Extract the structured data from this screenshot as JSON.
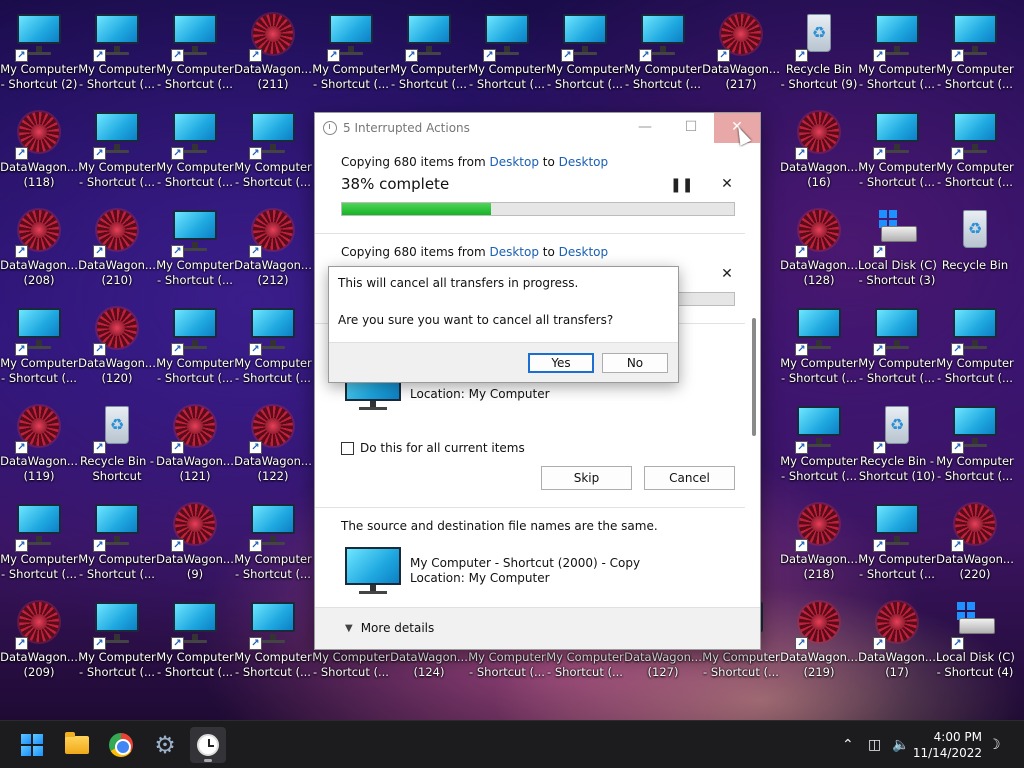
{
  "desktop_icons": [
    {
      "label1": "My Computer",
      "label2": "- Shortcut (2)",
      "kind": "monitor"
    },
    {
      "label1": "My Computer",
      "label2": "- Shortcut (...",
      "kind": "monitor"
    },
    {
      "label1": "My Computer",
      "label2": "- Shortcut (...",
      "kind": "monitor"
    },
    {
      "label1": "DataWagon...",
      "label2": "(211)",
      "kind": "flower"
    },
    {
      "label1": "My Computer",
      "label2": "- Shortcut (...",
      "kind": "monitor"
    },
    {
      "label1": "My Computer",
      "label2": "- Shortcut (...",
      "kind": "monitor"
    },
    {
      "label1": "My Computer",
      "label2": "- Shortcut (...",
      "kind": "monitor"
    },
    {
      "label1": "My Computer",
      "label2": "- Shortcut (...",
      "kind": "monitor"
    },
    {
      "label1": "My Computer",
      "label2": "- Shortcut (...",
      "kind": "monitor"
    },
    {
      "label1": "DataWagon...",
      "label2": "(217)",
      "kind": "flower"
    },
    {
      "label1": "Recycle Bin",
      "label2": "- Shortcut (9)",
      "kind": "bin"
    },
    {
      "label1": "My Computer",
      "label2": "- Shortcut (...",
      "kind": "monitor"
    },
    {
      "label1": "My Computer",
      "label2": "- Shortcut (...",
      "kind": "monitor"
    },
    {
      "label1": "DataWagon...",
      "label2": "(118)",
      "kind": "flower"
    },
    {
      "label1": "My Computer",
      "label2": "- Shortcut (...",
      "kind": "monitor"
    },
    {
      "label1": "My Computer",
      "label2": "- Shortcut (...",
      "kind": "monitor"
    },
    {
      "label1": "My Computer",
      "label2": "- Shortcut (...",
      "kind": "monitor"
    },
    {
      "label1": "DataWagon...",
      "label2": "(16)",
      "kind": "flower"
    },
    {
      "label1": "My Computer",
      "label2": "- Shortcut (...",
      "kind": "monitor"
    },
    {
      "label1": "My Computer",
      "label2": "- Shortcut (...",
      "kind": "monitor"
    },
    {
      "label1": "DataWagon...",
      "label2": "(208)",
      "kind": "flower"
    },
    {
      "label1": "DataWagon...",
      "label2": "(210)",
      "kind": "flower"
    },
    {
      "label1": "My Computer",
      "label2": "- Shortcut (...",
      "kind": "monitor"
    },
    {
      "label1": "DataWagon...",
      "label2": "(212)",
      "kind": "flower"
    },
    {
      "label1": "DataWagon...",
      "label2": "(128)",
      "kind": "flower"
    },
    {
      "label1": "Local Disk (C)",
      "label2": "- Shortcut (3)",
      "kind": "disk"
    },
    {
      "label1": "Recycle Bin",
      "label2": "",
      "kind": "bin"
    },
    {
      "label1": "My Computer",
      "label2": "- Shortcut (...",
      "kind": "monitor"
    },
    {
      "label1": "DataWagon...",
      "label2": "(120)",
      "kind": "flower"
    },
    {
      "label1": "My Computer",
      "label2": "- Shortcut (...",
      "kind": "monitor"
    },
    {
      "label1": "My Computer",
      "label2": "- Shortcut (...",
      "kind": "monitor"
    },
    {
      "label1": "My Computer",
      "label2": "- Shortcut (...",
      "kind": "monitor"
    },
    {
      "label1": "My Computer",
      "label2": "- Shortcut (...",
      "kind": "monitor"
    },
    {
      "label1": "My Computer",
      "label2": "- Shortcut (...",
      "kind": "monitor"
    },
    {
      "label1": "DataWagon...",
      "label2": "(119)",
      "kind": "flower"
    },
    {
      "label1": "Recycle Bin -",
      "label2": "Shortcut",
      "kind": "bin"
    },
    {
      "label1": "DataWagon...",
      "label2": "(121)",
      "kind": "flower"
    },
    {
      "label1": "DataWagon...",
      "label2": "(122)",
      "kind": "flower"
    },
    {
      "label1": "My Computer",
      "label2": "- Shortcut (...",
      "kind": "monitor"
    },
    {
      "label1": "Recycle Bin -",
      "label2": "Shortcut (10)",
      "kind": "bin"
    },
    {
      "label1": "My Computer",
      "label2": "- Shortcut (...",
      "kind": "monitor"
    },
    {
      "label1": "My Computer",
      "label2": "- Shortcut (...",
      "kind": "monitor"
    },
    {
      "label1": "My Computer",
      "label2": "- Shortcut (...",
      "kind": "monitor"
    },
    {
      "label1": "DataWagon...",
      "label2": "(9)",
      "kind": "flower"
    },
    {
      "label1": "My Computer",
      "label2": "- Shortcut (...",
      "kind": "monitor"
    },
    {
      "label1": "DataWagon...",
      "label2": "(218)",
      "kind": "flower"
    },
    {
      "label1": "My Computer",
      "label2": "- Shortcut (...",
      "kind": "monitor"
    },
    {
      "label1": "DataWagon...",
      "label2": "(220)",
      "kind": "flower"
    },
    {
      "label1": "DataWagon...",
      "label2": "(209)",
      "kind": "flower"
    },
    {
      "label1": "My Computer",
      "label2": "- Shortcut (...",
      "kind": "monitor"
    },
    {
      "label1": "My Computer",
      "label2": "- Shortcut (...",
      "kind": "monitor"
    },
    {
      "label1": "My Computer",
      "label2": "- Shortcut (...",
      "kind": "monitor"
    },
    {
      "label1": "My Computer",
      "label2": "- Shortcut (...",
      "kind": "monitor"
    },
    {
      "label1": "DataWagon...",
      "label2": "(124)",
      "kind": "flower"
    },
    {
      "label1": "My Computer",
      "label2": "- Shortcut (...",
      "kind": "monitor"
    },
    {
      "label1": "My Computer",
      "label2": "- Shortcut (...",
      "kind": "monitor"
    },
    {
      "label1": "DataWagon...",
      "label2": "(127)",
      "kind": "flower"
    },
    {
      "label1": "My Computer",
      "label2": "- Shortcut (...",
      "kind": "monitor"
    },
    {
      "label1": "DataWagon...",
      "label2": "(219)",
      "kind": "flower"
    },
    {
      "label1": "DataWagon...",
      "label2": "(17)",
      "kind": "flower"
    },
    {
      "label1": "Local Disk (C)",
      "label2": "- Shortcut (4)",
      "kind": "disk"
    }
  ],
  "progress_dialog": {
    "title": "5 Interrupted Actions",
    "op1": {
      "prefix": "Copying 680 items from ",
      "src": "Desktop",
      "mid": " to ",
      "dst": "Desktop",
      "percent_label": "38% complete",
      "progress": 0.38
    },
    "op2": {
      "prefix": "Copying 680 items from ",
      "src": "Desktop",
      "mid": " to ",
      "dst": "Desktop",
      "progress": 0.0
    },
    "conflict1": {
      "location": "Location: My Computer"
    },
    "checkbox_label": "Do this for all current items",
    "skip": "Skip",
    "cancel": "Cancel",
    "message": "The source and destination file names are the same.",
    "conflict2": {
      "name": "My Computer - Shortcut (2000) - Copy",
      "location": "Location: My Computer"
    },
    "more_details": "More details"
  },
  "confirm_dialog": {
    "line1": "This will cancel all transfers in progress.",
    "line2": "Are you sure you want to cancel all transfers?",
    "yes": "Yes",
    "no": "No"
  },
  "taskbar": {
    "time": "4:00 PM",
    "date": "11/14/2022"
  },
  "colors": {
    "progress_green": "#16b325",
    "link_blue": "#1a5fb4",
    "close_hover": "#e8a8a8"
  }
}
